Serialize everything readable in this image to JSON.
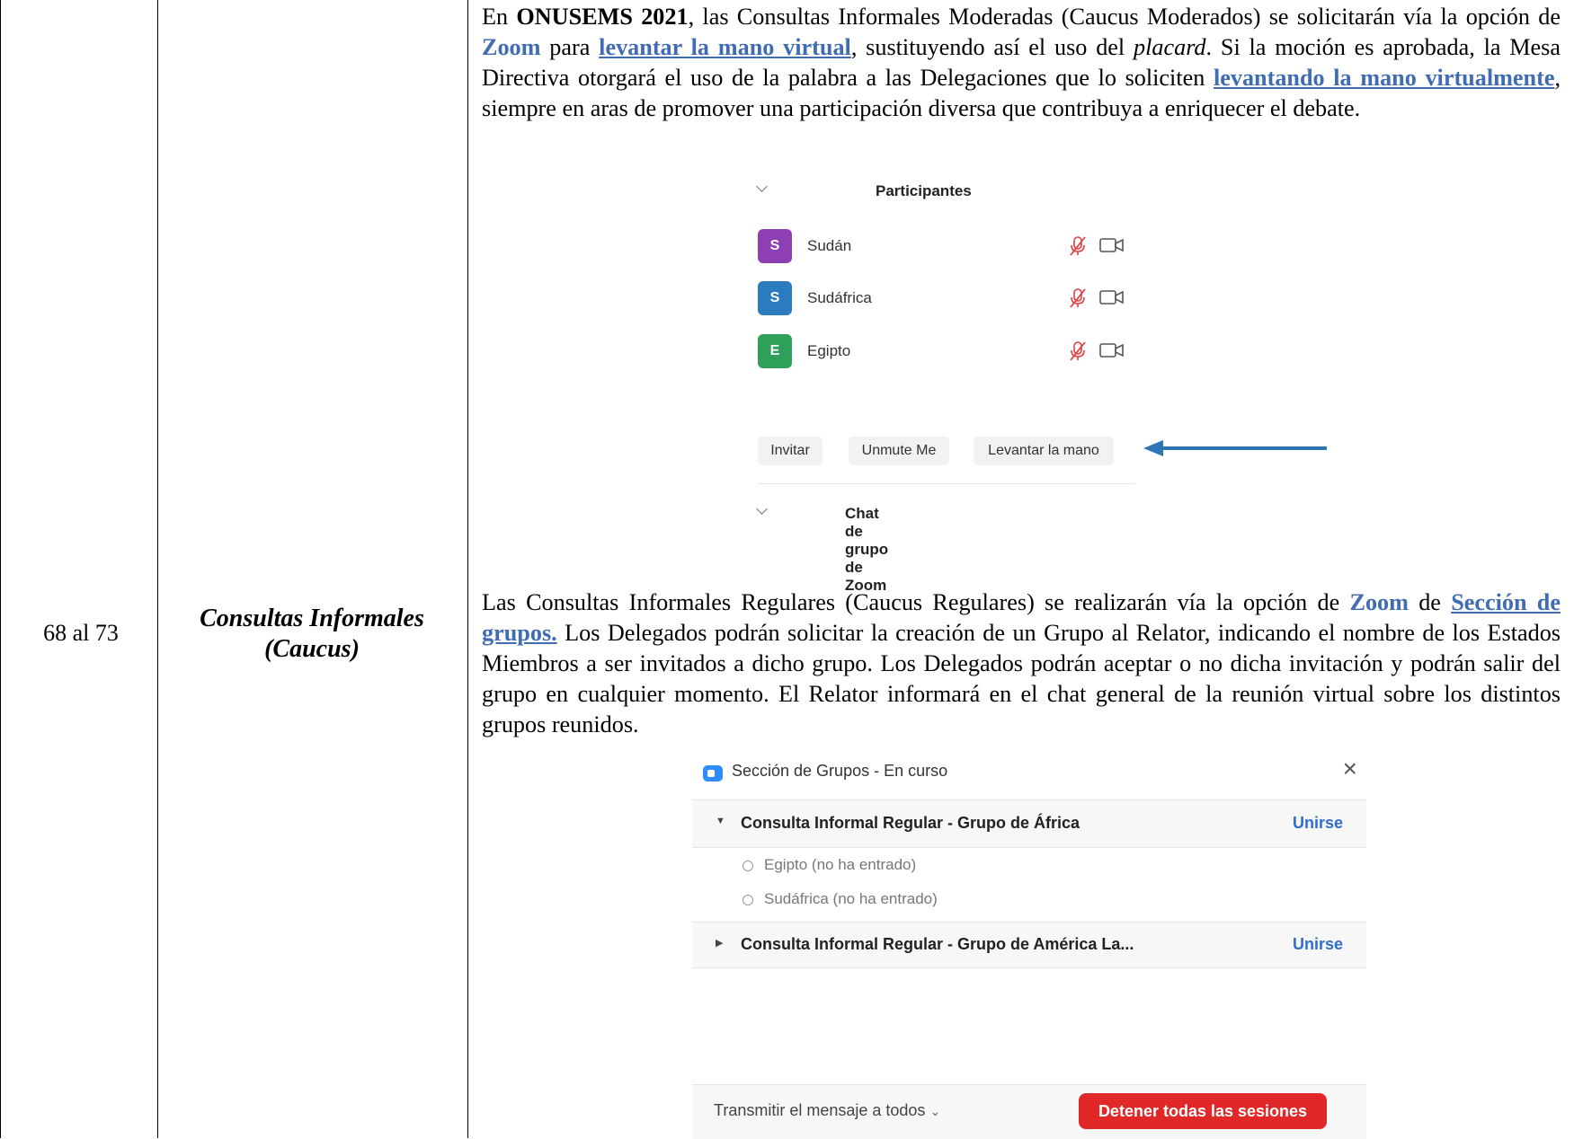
{
  "table": {
    "row_number": "68 al 73",
    "row_title_line1": "Consultas Informales",
    "row_title_line2": "(Caucus)"
  },
  "paragraph1": {
    "t1": "En ",
    "b1": "ONUSEMS 2021",
    "t2": ", las Consultas Informales Moderadas (Caucus Moderados) se solicitarán vía la opción de ",
    "zoom": "Zoom",
    "t3": " para ",
    "link1": "levantar la mano virtual",
    "t4": ", sustituyendo así el uso del ",
    "i1": "placard",
    "t5": ".  Si la moción es aprobada, la Mesa Directiva otorgará el uso de la palabra a las Delegaciones que lo soliciten ",
    "link2": "levantando la mano virtualmente",
    "t6": ", siempre en aras de promover una participación diversa que contribuya a enriquecer el debate."
  },
  "participants_panel": {
    "header": "Participantes",
    "participants": [
      {
        "initial": "S",
        "name": "Sudán",
        "color": "#8e3fb4"
      },
      {
        "initial": "S",
        "name": "Sudáfrica",
        "color": "#2b7bbf"
      },
      {
        "initial": "E",
        "name": "Egipto",
        "color": "#2fa05a"
      }
    ],
    "buttons": {
      "invite": "Invitar",
      "unmute": "Unmute Me",
      "raise_hand": "Levantar la mano"
    },
    "chat_header": "Chat de grupo de Zoom",
    "arrow_color": "#2e75b6"
  },
  "paragraph2": {
    "t1": "Las Consultas Informales Regulares (Caucus Regulares) se realizarán vía la opción de ",
    "zoom": "Zoom",
    "t2": " de ",
    "link1": "Sección de grupos.",
    "t3": "  Los Delegados podrán solicitar la creación de un Grupo al Relator, indicando el nombre de los Estados Miembros a ser invitados a dicho grupo.  Los Delegados podrán aceptar o no dicha invitación y podrán salir del grupo en cualquier momento.  El Relator informará en el chat general de la reunión virtual sobre los distintos grupos reunidos."
  },
  "groups_panel": {
    "title": "Sección de Grupos - En curso",
    "close": "×",
    "groups": [
      {
        "name": "Consulta Informal Regular - Grupo de África",
        "join": "Unirse",
        "members": [
          "Egipto (no ha entrado)",
          "Sudáfrica (no ha entrado)"
        ]
      },
      {
        "name": "Consulta Informal Regular - Grupo de América La...",
        "join": "Unirse"
      }
    ],
    "broadcast": "Transmitir el mensaje a todos",
    "stop_all": "Detener todas las sesiones"
  }
}
